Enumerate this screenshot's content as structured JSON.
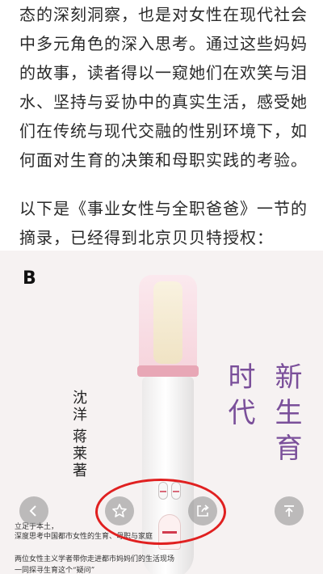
{
  "article": {
    "paragraph1": [
      "态的深刻洞察，也是对女性在现代社会",
      "中多元角色的深入思考。通过这些妈妈",
      "的故事，读者得以一窥她们在欢笑与泪",
      "水、坚持与妥协中的真实生活，感受她",
      "们在传统与现代交融的性别环境下，如",
      "何面对生育的决策和母职实践的考验。"
    ],
    "paragraph2": [
      "以下是《事业女性与全职爸爸》一节的",
      "摘录，已经得到北京贝贝特授权："
    ]
  },
  "cover": {
    "logo": "B",
    "title_col1": "新生育",
    "title_col2": "时代",
    "author1": "沈洋",
    "author2": "蒋莱",
    "author_suffix": "著",
    "snippets": [
      "立足于本土，",
      "深度思考中国都市女性的生育、母职与家庭",
      "两位女性主义学者带你走进都市妈妈们的生活现场",
      "一同探寻生育这个“疑问”"
    ]
  },
  "controls": {
    "back_icon": "chevron-left-icon",
    "favorite_icon": "star-icon",
    "share_icon": "share-icon",
    "top_icon": "arrow-up-to-top-icon"
  },
  "colors": {
    "title_purple": "#7a4f9a",
    "highlight_red": "#e02020",
    "control_gray": "#8c8c8c"
  }
}
